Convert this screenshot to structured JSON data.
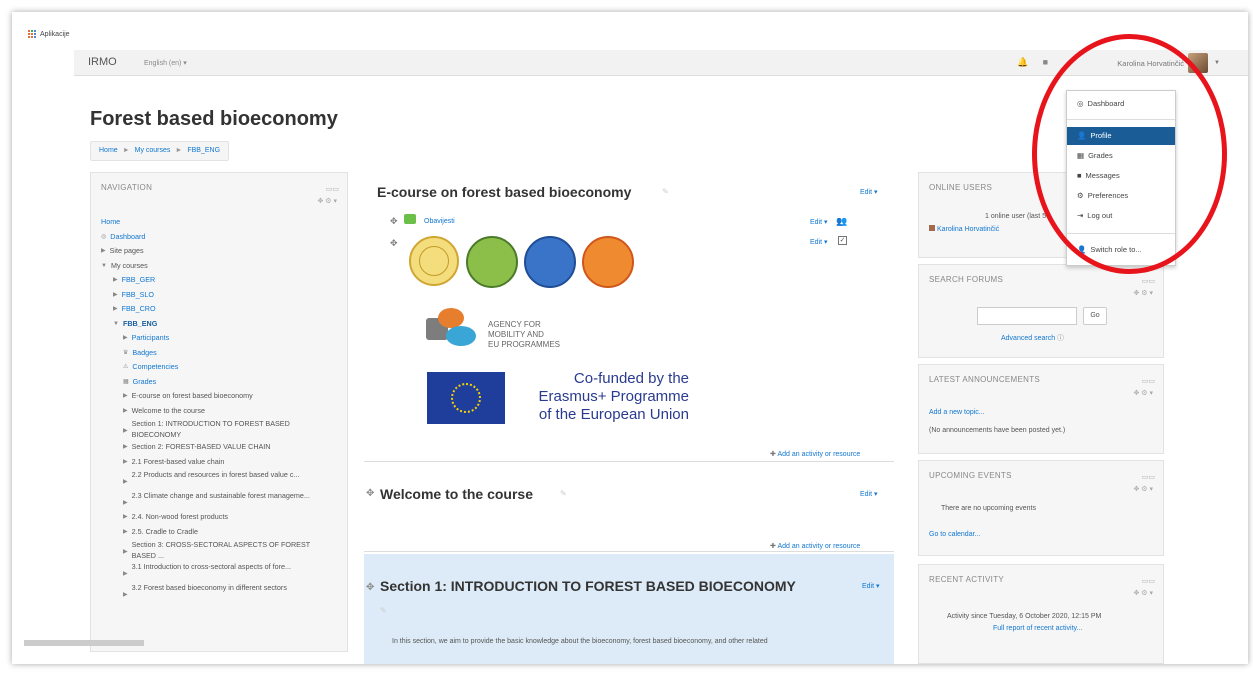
{
  "bookmarks": {
    "apps_label": "Aplikacije"
  },
  "navbar": {
    "brand": "IRMO",
    "language": "English (en) ▾",
    "user_name": "Karolina Horvatinčić"
  },
  "page": {
    "title": "Forest based bioeconomy",
    "breadcrumb": [
      "Home",
      "My courses",
      "FBB_ENG"
    ]
  },
  "navigation": {
    "title": "NAVIGATION",
    "items": [
      "Home",
      "Dashboard",
      "Site pages",
      "My courses",
      "FBB_GER",
      "FBB_SLO",
      "FBB_CRO",
      "FBB_ENG",
      "Participants",
      "Badges",
      "Competencies",
      "Grades",
      "E-course on forest based bioeconomy",
      "Welcome to the course",
      "Section 1: INTRODUCTION TO FOREST BASED BIOECONOMY",
      "Section 2: FOREST-BASED VALUE CHAIN",
      "2.1 Forest-based value chain",
      "2.2 Products and resources in forest based value c...",
      "2.3 Climate change and sustainable forest manageme...",
      "2.4. Non-wood forest products",
      "2.5. Cradle to Cradle",
      "Section 3: CROSS-SECTORAL ASPECTS OF FOREST BASED ...",
      "3.1 Introduction to cross-sectoral aspects of fore...",
      "3.2 Forest based bioeconomy in different sectors"
    ]
  },
  "main": {
    "section0_title": "E-course on forest based bioeconomy",
    "edit_label": "Edit ▾",
    "forum_link": "Obavijesti",
    "agency_text": [
      "AGENCY FOR",
      "MOBILITY AND",
      "EU PROGRAMMES"
    ],
    "cofunded_text": [
      "Co-funded by the",
      "Erasmus+ Programme",
      "of the European Union"
    ],
    "add_activity": "Add an activity or resource",
    "section_welcome": "Welcome to the course",
    "section1_title": "Section 1: INTRODUCTION TO FOREST BASED BIOECONOMY",
    "section1_text": "In this section, we aim to provide the basic knowledge about the bioeconomy, forest based bioeconomy, and other related"
  },
  "online_users": {
    "title": "ONLINE USERS",
    "summary": "1 online user (last 5",
    "user": "Karolina Horvatinčić"
  },
  "search_forums": {
    "title": "SEARCH FORUMS",
    "go": "Go",
    "advanced": "Advanced search"
  },
  "announcements": {
    "title": "LATEST ANNOUNCEMENTS",
    "add_topic": "Add a new topic...",
    "none": "(No announcements have been posted yet.)"
  },
  "upcoming": {
    "title": "UPCOMING EVENTS",
    "none": "There are no upcoming events",
    "calendar": "Go to calendar..."
  },
  "recent": {
    "title": "RECENT ACTIVITY",
    "since": "Activity since Tuesday, 6 October 2020, 12:15 PM",
    "full_report": "Full report of recent activity..."
  },
  "user_menu": {
    "dashboard": "Dashboard",
    "profile": "Profile",
    "grades": "Grades",
    "messages": "Messages",
    "preferences": "Preferences",
    "logout": "Log out",
    "switch_role": "Switch role to..."
  },
  "colors": {
    "accent": "#1177d1",
    "highlight": "#e8141c",
    "active_item": "#1a5d96",
    "section_bg": "#dcebf7"
  }
}
